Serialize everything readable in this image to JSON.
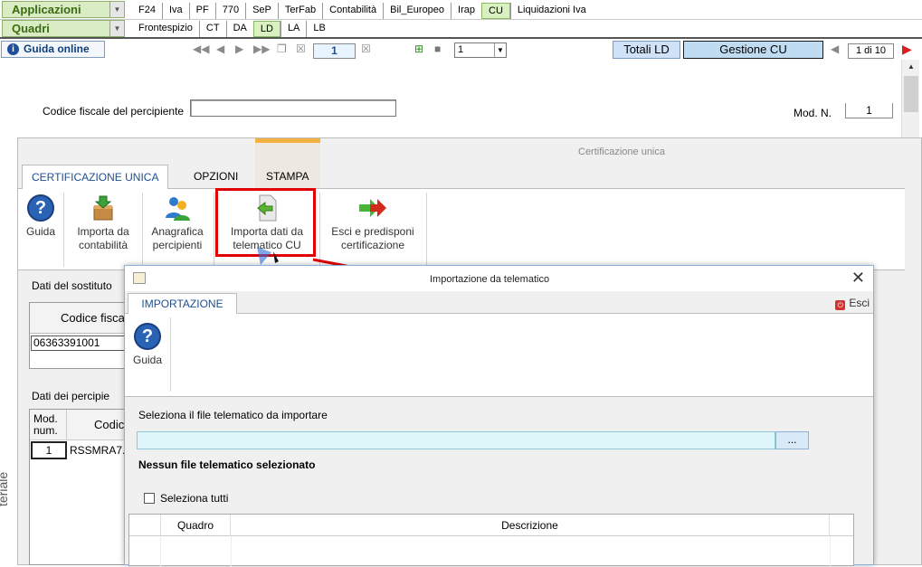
{
  "top": {
    "app_combo": "Applicazioni",
    "quadri_combo": "Quadri",
    "modules": [
      "F24",
      "Iva",
      "PF",
      "770",
      "SeP",
      "TerFab",
      "Contabilità",
      "Bil_Europeo",
      "Irap",
      "CU",
      "Liquidazioni Iva"
    ],
    "active_module": "CU",
    "quadri_tabs": [
      "Frontespizio",
      "CT",
      "DA",
      "LD",
      "LA",
      "LB"
    ],
    "active_quadro": "LD"
  },
  "toolbar": {
    "guida_online": "Guida online",
    "page_number": "1",
    "select_value": "1",
    "totali_label": "Totali LD",
    "gestione_label": "Gestione CU",
    "pager": "1 di 10"
  },
  "form": {
    "cf_label": "Codice fiscale del percipiente",
    "mod_label": "Mod. N.",
    "mod_value": "1"
  },
  "cert": {
    "title": "Certificazione unica",
    "tabs": [
      "CERTIFICAZIONE UNICA",
      "OPZIONI",
      "STAMPA"
    ],
    "buttons": {
      "guida": "Guida",
      "importa_contabilita_1": "Importa da",
      "importa_contabilita_2": "contabilità",
      "anagrafica_1": "Anagrafica",
      "anagrafica_2": "percipienti",
      "importa_tel_1": "Importa dati da",
      "importa_tel_2": "telematico CU",
      "esci_1": "Esci e predisponi",
      "esci_2": "certificazione"
    },
    "sostituto_label": "Dati del sostituto",
    "codice_fiscale_header": "Codice fisca",
    "codice_fiscale_value": "06363391001",
    "percipienti_label": "Dati dei percipie",
    "mod_num_header_1": "Mod.",
    "mod_num_header_2": "num.",
    "codic_header": "Codic",
    "row_mod": "1",
    "row_cf": "RSSMRA7.",
    "vertical_text": "teriale"
  },
  "dialog": {
    "title": "Importazione da telematico",
    "tab": "IMPORTAZIONE",
    "esci": "Esci",
    "guida": "Guida",
    "select_file": "Seleziona il file telematico da importare",
    "browse": "...",
    "no_file": "Nessun file telematico selezionato",
    "select_all": "Seleziona tutti",
    "col_quadro": "Quadro",
    "col_descrizione": "Descrizione"
  },
  "colors": {
    "highlight": "#e10000",
    "accent_blue": "#1f4f8f",
    "active_green": "#d9f0c1"
  }
}
